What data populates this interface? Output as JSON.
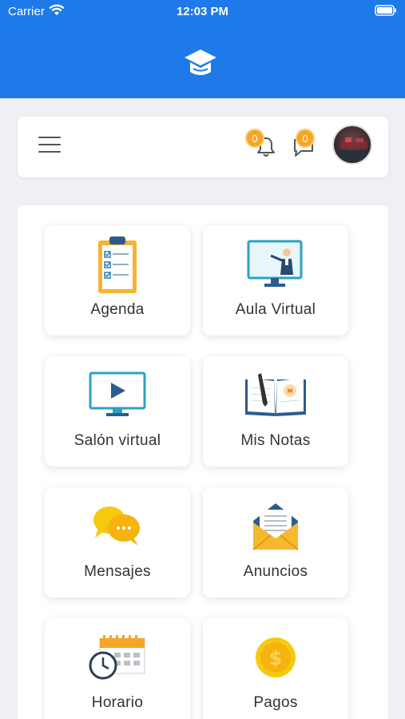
{
  "status_bar": {
    "carrier": "Carrier",
    "time": "12:03 PM"
  },
  "header": {
    "notifications_count": "0",
    "messages_count": "0"
  },
  "tiles": [
    {
      "label": "Agenda",
      "icon": "clipboard-checklist-icon"
    },
    {
      "label": "Aula Virtual",
      "icon": "teacher-screen-icon"
    },
    {
      "label": "Salón virtual",
      "icon": "video-monitor-icon"
    },
    {
      "label": "Mis Notas",
      "icon": "notebook-pen-icon"
    },
    {
      "label": "Mensajes",
      "icon": "chat-bubbles-icon"
    },
    {
      "label": "Anuncios",
      "icon": "envelope-letter-icon"
    },
    {
      "label": "Horario",
      "icon": "calendar-clock-icon"
    },
    {
      "label": "Pagos",
      "icon": "dollar-coin-icon"
    }
  ],
  "colors": {
    "primary": "#1e7ae8",
    "badge": "#f6a623",
    "background": "#eef0f3"
  }
}
